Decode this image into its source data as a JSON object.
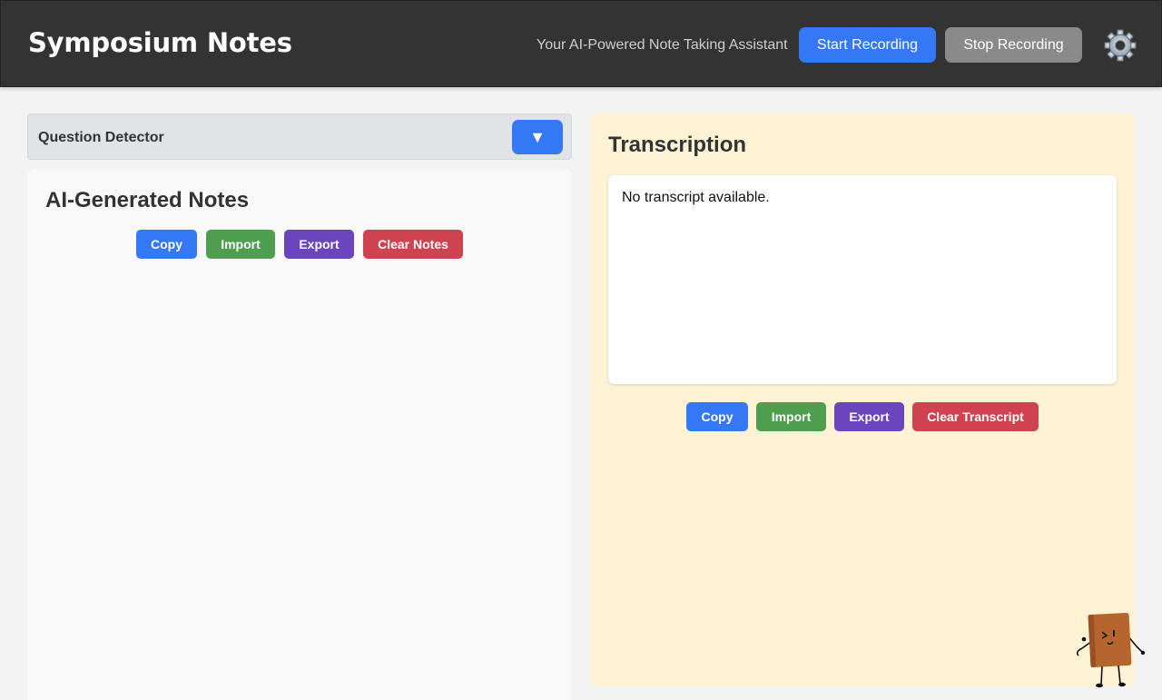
{
  "header": {
    "title": "Symposium Notes",
    "tagline": "Your AI-Powered Note Taking Assistant",
    "start_label": "Start Recording",
    "stop_label": "Stop Recording",
    "settings_icon": "gear-icon"
  },
  "question_detector": {
    "label": "Question Detector",
    "toggle_symbol": "▼"
  },
  "notes": {
    "title": "AI-Generated Notes",
    "buttons": {
      "copy": "Copy",
      "import": "Import",
      "export": "Export",
      "clear": "Clear Notes"
    }
  },
  "transcription": {
    "title": "Transcription",
    "text": "No transcript available.",
    "buttons": {
      "copy": "Copy",
      "import": "Import",
      "export": "Export",
      "clear": "Clear Transcript"
    }
  },
  "colors": {
    "header_bg": "#333333",
    "primary_blue": "#3478f6",
    "stop_gray": "#8a8a8a",
    "import_green": "#4f9d4f",
    "export_purple": "#6a45bd",
    "clear_red": "#cf4350",
    "transcription_bg": "#fef3d5"
  },
  "mascot_icon": "notebook-mascot-icon"
}
